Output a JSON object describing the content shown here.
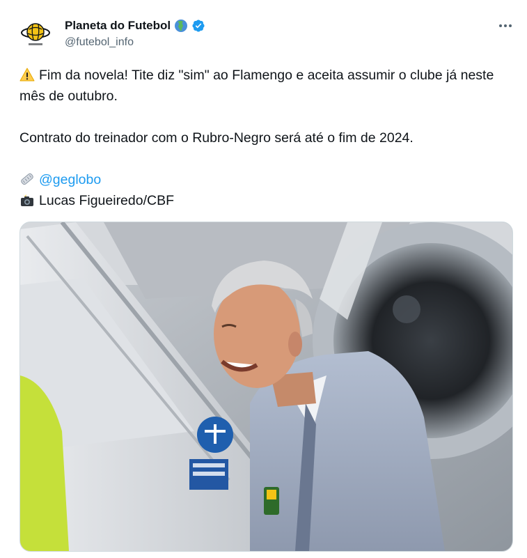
{
  "author": {
    "display_name": "Planeta do Futebol",
    "handle": "@futebol_info"
  },
  "icons": {
    "globe": "globe-americas-icon",
    "verified": "verified-badge-icon",
    "more": "more-options-icon",
    "warning": "warning-icon",
    "newspaper": "rolled-newspaper-icon",
    "camera": "camera-flash-icon"
  },
  "tweet": {
    "line1": "Fim da novela! Tite diz \"sim\" ao Flamengo e aceita assumir o clube já neste mês de outubro.",
    "line2": "Contrato do treinador com o Rubro-Negro será até o fim de 2024.",
    "source_mention": "@geglobo",
    "photo_credit": "Lucas Figueiredo/CBF"
  },
  "colors": {
    "accent": "#1d9bf0",
    "text": "#0f1419",
    "secondary": "#536471"
  }
}
